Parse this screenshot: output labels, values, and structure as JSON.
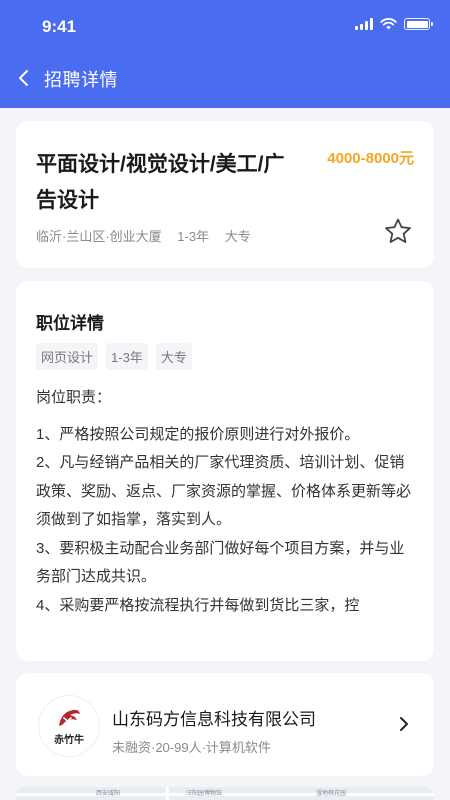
{
  "status_bar": {
    "time": "9:41"
  },
  "nav": {
    "title": "招聘详情"
  },
  "job": {
    "title": "平面设计/视觉设计/美工/广告设计",
    "salary": "4000-8000元",
    "location": "临沂·兰山区·创业大厦",
    "experience": "1-3年",
    "education": "大专"
  },
  "details": {
    "section_title": "职位详情",
    "tags": [
      "网页设计",
      "1-3年",
      "大专"
    ],
    "responsibilities_title": "岗位职责：",
    "responsibilities": [
      "1、严格按照公司规定的报价原则进行对外报价。",
      "2、凡与经销产品相关的厂家代理资质、培训计划、促销政策、奖励、返点、厂家资源的掌握、价格体系更新等必须做到了如指掌，落实到人。",
      "3、要积极主动配合业务部门做好每个项目方案，并与业务部门达成共识。",
      "4、采购要严格按流程执行并每做到货比三家，控"
    ]
  },
  "company": {
    "logo_text": "赤竹牛",
    "name": "山东码方信息科技有限公司",
    "meta": "未融资·20-99人·计算机软件"
  },
  "map": {
    "labels": [
      "西安咸阳",
      "汪阳园博物馆",
      "湿地桃花园"
    ]
  },
  "colors": {
    "header": "#4a6cf0",
    "salary": "#f5a623",
    "background": "#f4f5f9"
  }
}
